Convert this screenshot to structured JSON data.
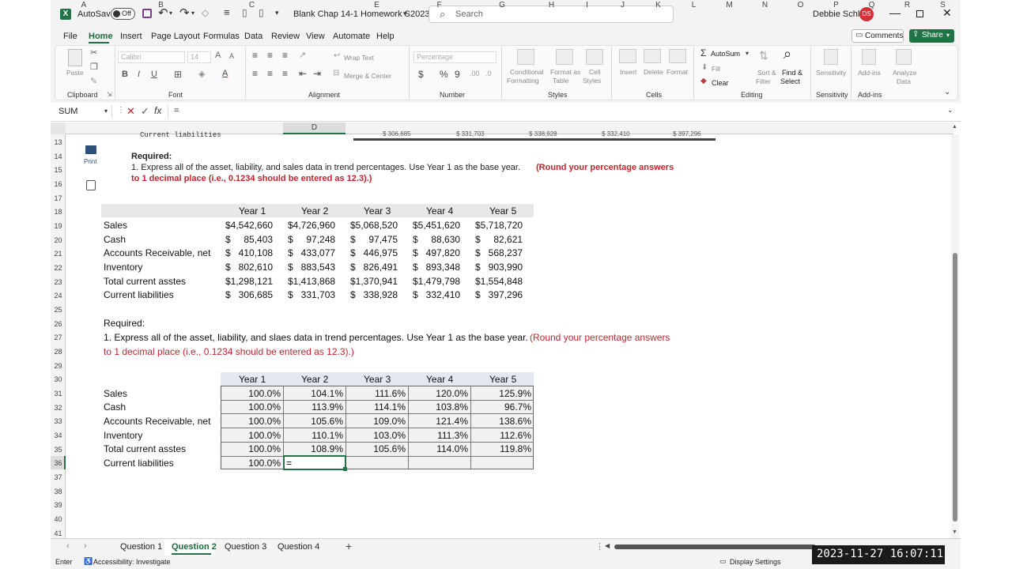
{
  "titlebar": {
    "autosave_label": "AutoSave",
    "autosave_state": "Off",
    "doc_title": "Blank Chap 14-1 Homework S2023...",
    "search_placeholder": "Search",
    "user_name": "Debbie Schley",
    "user_initials": "DS"
  },
  "menu": {
    "tabs": [
      "File",
      "Home",
      "Insert",
      "Page Layout",
      "Formulas",
      "Data",
      "Review",
      "View",
      "Automate",
      "Help"
    ],
    "active": "Home",
    "comments_label": "Comments",
    "share_label": "Share"
  },
  "ribbon": {
    "clipboard": {
      "paste": "Paste",
      "label": "Clipboard"
    },
    "font": {
      "font_name": "Calibri",
      "font_size": "14",
      "label": "Font"
    },
    "alignment": {
      "wrap": "Wrap Text",
      "merge": "Merge & Center",
      "label": "Alignment"
    },
    "number": {
      "format": "Percentage",
      "label": "Number"
    },
    "styles": {
      "conditional": "Conditional",
      "conditional2": "Formatting",
      "format_table": "Format as",
      "format_table2": "Table",
      "cell_styles": "Cell",
      "cell_styles2": "Styles",
      "label": "Styles"
    },
    "cells": {
      "insert": "Insert",
      "delete": "Delete",
      "format": "Format",
      "label": "Cells"
    },
    "editing": {
      "autosum": "AutoSum",
      "fill": "Fill",
      "clear": "Clear",
      "sort": "Sort &",
      "sort2": "Filter",
      "find": "Find &",
      "find2": "Select",
      "label": "Editing"
    },
    "sensitivity": {
      "name": "Sensitivity",
      "label": "Sensitivity"
    },
    "addins": {
      "name": "Add-ins",
      "analyze": "Analyze",
      "analyze2": "Data",
      "label": "Add-ins"
    }
  },
  "formula_bar": {
    "name_box": "SUM",
    "formula": "="
  },
  "columns": [
    "A",
    "B",
    "C",
    "D",
    "E",
    "F",
    "G",
    "H",
    "I",
    "J",
    "K",
    "L",
    "M",
    "N",
    "O",
    "P",
    "Q",
    "R",
    "S"
  ],
  "rows": [
    "13",
    "14",
    "15",
    "16",
    "17",
    "18",
    "19",
    "20",
    "21",
    "22",
    "23",
    "24",
    "25",
    "26",
    "27",
    "28",
    "29",
    "30",
    "31",
    "32",
    "33",
    "34",
    "35",
    "36",
    "37",
    "38",
    "39",
    "40",
    "41"
  ],
  "image_area": {
    "print_label": "Print",
    "top_partial": "Current liabilities",
    "top_partial_values": [
      "$ 306,685",
      "$ 331,703",
      "$ 338,928",
      "$ 332,410",
      "$ 397,296"
    ],
    "required": "Required:",
    "instruction": "1. Express all of the asset, liability, and sales data in trend percentages. Use Year 1 as the base year.",
    "instruction_red": "(Round your percentage answers",
    "instruction_red2": "to 1 decimal place (i.e., 0.1234 should be entered as 12.3).)"
  },
  "table1": {
    "years": [
      "Year 1",
      "Year 2",
      "Year 3",
      "Year 4",
      "Year 5"
    ],
    "rows": [
      {
        "label": "Sales",
        "values": [
          "$4,542,660",
          "$4,726,960",
          "$5,068,520",
          "$5,451,620",
          "$5,718,720"
        ]
      },
      {
        "label": "Cash",
        "values": [
          "$     85,403",
          "$     97,248",
          "$     97,475",
          "$     88,630",
          "$     82,621"
        ]
      },
      {
        "label": "Accounts Receivable, net",
        "values": [
          "$   410,108",
          "$   433,077",
          "$   446,975",
          "$   497,820",
          "$   568,237"
        ]
      },
      {
        "label": "Inventory",
        "values": [
          "$   802,610",
          "$   883,543",
          "$   826,491",
          "$   893,348",
          "$   903,990"
        ]
      },
      {
        "label": "Total current asstes",
        "values": [
          "$1,298,121",
          "$1,413,868",
          "$1,370,941",
          "$1,479,798",
          "$1,554,848"
        ]
      },
      {
        "label": "Current liabilities",
        "values": [
          "$   306,685",
          "$   331,703",
          "$   338,928",
          "$   332,410",
          "$   397,296"
        ]
      }
    ]
  },
  "required2": {
    "heading": "Required:",
    "line1": "1. Express all of the asset, liability, and slaes data in trend percentages. Use Year 1 as the base year.",
    "line1_red": "(Round your percentage answers",
    "line2_red": "to 1 decimal place (i.e., 0.1234 should be entered as 12.3).)"
  },
  "table2": {
    "years": [
      "Year 1",
      "Year 2",
      "Year 3",
      "Year 4",
      "Year 5"
    ],
    "rows": [
      {
        "label": "Sales",
        "values": [
          "100.0%",
          "104.1%",
          "111.6%",
          "120.0%",
          "125.9%"
        ]
      },
      {
        "label": "Cash",
        "values": [
          "100.0%",
          "113.9%",
          "114.1%",
          "103.8%",
          "96.7%"
        ]
      },
      {
        "label": "Accounts Receivable, net",
        "values": [
          "100.0%",
          "105.6%",
          "109.0%",
          "121.4%",
          "138.6%"
        ]
      },
      {
        "label": "Inventory",
        "values": [
          "100.0%",
          "110.1%",
          "103.0%",
          "111.3%",
          "112.6%"
        ]
      },
      {
        "label": "Total current asstes",
        "values": [
          "100.0%",
          "108.9%",
          "105.6%",
          "114.0%",
          "119.8%"
        ]
      },
      {
        "label": "Current liabilities",
        "values": [
          "100.0%",
          "=",
          "",
          "",
          ""
        ]
      }
    ]
  },
  "sheets": {
    "tabs": [
      "Question 1",
      "Question 2",
      "Question 3",
      "Question 4"
    ],
    "active": "Question 2"
  },
  "status": {
    "mode": "Enter",
    "accessibility": "Accessibility: Investigate",
    "display_settings": "Display Settings"
  },
  "timestamp": "2023-11-27  16:07:11",
  "colors": {
    "accent": "#217346",
    "red_text": "#c0262d",
    "header_band": "#e8e8e8",
    "avatar": "#d13438"
  }
}
